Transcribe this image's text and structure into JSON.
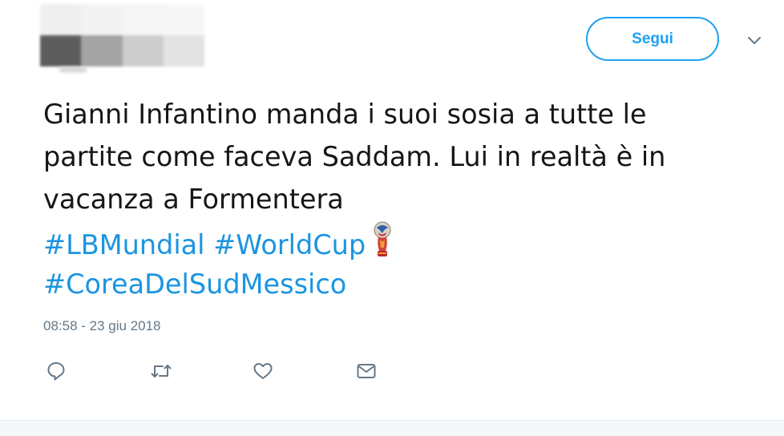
{
  "header": {
    "follow_label": "Segui"
  },
  "tweet": {
    "text_lines": [
      "Gianni Infantino manda i suoi sosia a tutte le",
      "partite come faceva Saddam. Lui in realtà è in",
      "vacanza a Formentera"
    ],
    "hashtags": [
      "#LBMundial",
      "#WorldCup",
      "#CoreaDelSudMessico"
    ],
    "timestamp": "08:58 - 23 giu 2018"
  },
  "icons": {
    "more": "chevron-down-icon",
    "emoji": "world-cup-trophy-emoji",
    "actions": [
      "reply-icon",
      "retweet-icon",
      "like-icon",
      "direct-message-icon"
    ]
  },
  "colors": {
    "accent": "#1da1f2",
    "hashtag": "#1b95e0",
    "text": "#14171a",
    "muted": "#657786"
  }
}
